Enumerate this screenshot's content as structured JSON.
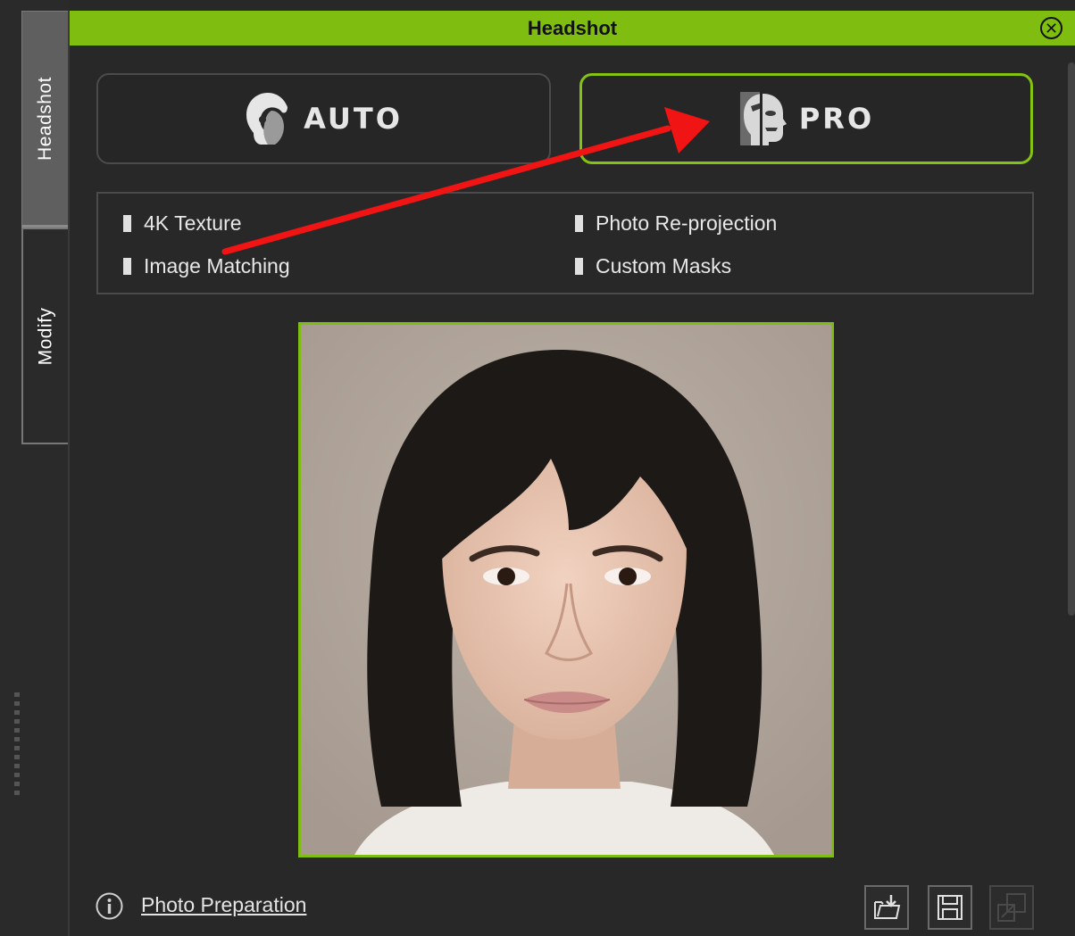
{
  "side_tabs": [
    {
      "label": "Headshot",
      "active": true
    },
    {
      "label": "Modify",
      "active": false
    }
  ],
  "panel": {
    "title": "Headshot",
    "close_icon": "close-circle-icon"
  },
  "modes": {
    "auto": {
      "label": "AUTO",
      "icon": "auto-face-icon",
      "selected": false
    },
    "pro": {
      "label": "PRO",
      "icon": "pro-face-icon",
      "selected": true
    }
  },
  "features": [
    {
      "label": "4K Texture"
    },
    {
      "label": "Photo Re-projection"
    },
    {
      "label": "Image Matching"
    },
    {
      "label": "Custom Masks"
    }
  ],
  "photo": {
    "subject": "headshot-photo"
  },
  "footer": {
    "info_icon": "info-icon",
    "photo_preparation_label": "Photo Preparation",
    "tools": [
      {
        "name": "load-photo",
        "icon": "folder-download-icon",
        "enabled": true
      },
      {
        "name": "save",
        "icon": "floppy-disk-icon",
        "enabled": true
      },
      {
        "name": "export",
        "icon": "export-icon",
        "enabled": false
      }
    ]
  },
  "colors": {
    "accent": "#7fbe10",
    "background": "#282828",
    "annotation_arrow": "#f01414"
  }
}
